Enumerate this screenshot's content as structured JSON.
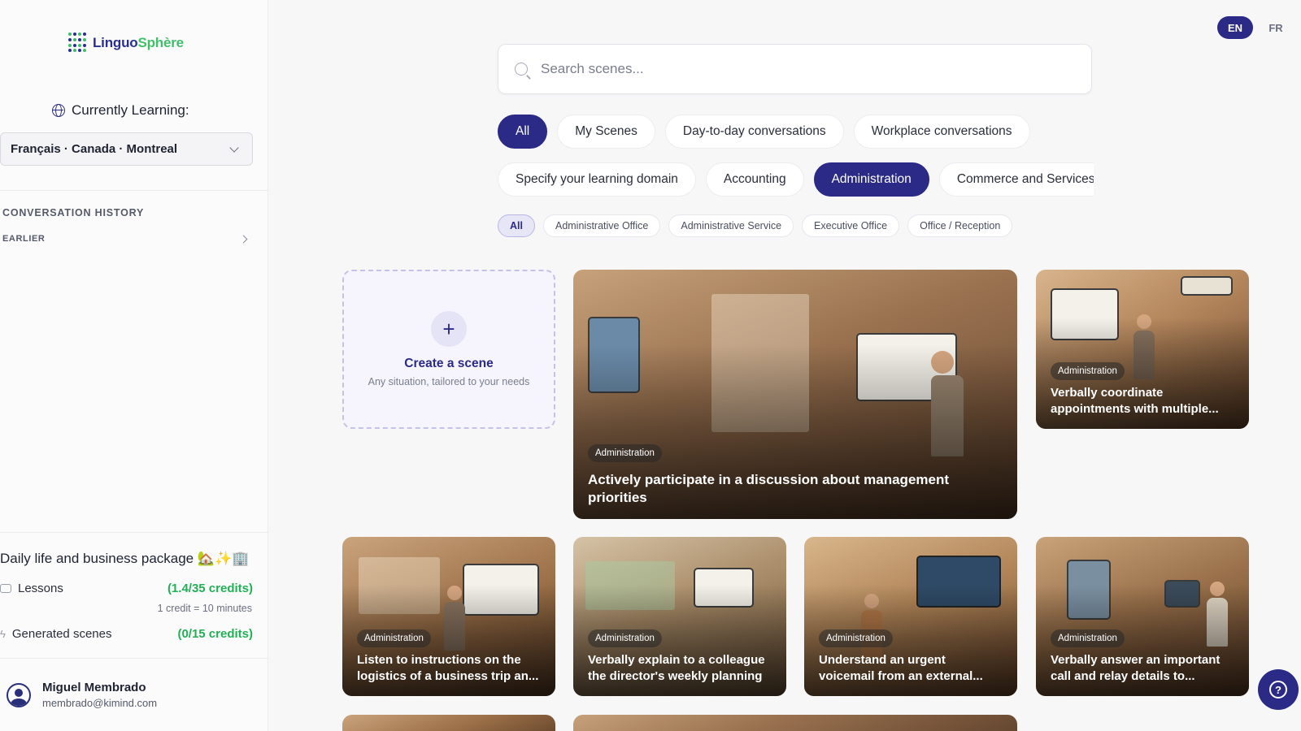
{
  "brand": {
    "part1": "Linguo",
    "part2": "Sphère"
  },
  "sidebar": {
    "currently_learning_label": "Currently Learning:",
    "language_select_value": "Français · Canada · Montreal",
    "conversation_history_label": "CONVERSATION HISTORY",
    "earlier_label": "EARLIER",
    "package_title": "Daily life and business package 🏡✨🏢",
    "lessons_label": "Lessons",
    "lessons_credits": "(1.4/35 credits)",
    "credit_note": "1 credit = 10 minutes",
    "generated_label": "Generated scenes",
    "generated_credits": "(0/15 credits)"
  },
  "user": {
    "name": "Miguel Membrado",
    "email": "membrado@kimind.com"
  },
  "lang_toggle": {
    "en": "EN",
    "fr": "FR",
    "active": "EN"
  },
  "search": {
    "placeholder": "Search scenes..."
  },
  "tabs_row1": [
    "All",
    "My Scenes",
    "Day-to-day conversations",
    "Workplace conversations"
  ],
  "tabs_row2": [
    "Specify your learning domain",
    "Accounting",
    "Administration",
    "Commerce and Services"
  ],
  "subfilters": [
    "All",
    "Administrative Office",
    "Administrative Service",
    "Executive Office",
    "Office / Reception"
  ],
  "create_card": {
    "plus": "+",
    "title": "Create a scene",
    "subtitle": "Any situation, tailored to your needs"
  },
  "scenes": [
    {
      "tag": "Administration",
      "title": "Actively participate in a discussion about management priorities"
    },
    {
      "tag": "Administration",
      "title": "Verbally coordinate appointments with multiple..."
    },
    {
      "tag": "Administration",
      "title": "Listen to instructions on the logistics of a business trip an..."
    },
    {
      "tag": "Administration",
      "title": "Verbally explain to a colleague the director's weekly planning"
    },
    {
      "tag": "Administration",
      "title": "Understand an urgent voicemail from an external..."
    },
    {
      "tag": "Administration",
      "title": "Verbally answer an important call and relay details to..."
    }
  ],
  "help": {
    "icon_glyph": "?"
  },
  "colors": {
    "accent": "#2b2a86",
    "credits_green": "#22b055",
    "brand_green": "#3fbf6a"
  }
}
